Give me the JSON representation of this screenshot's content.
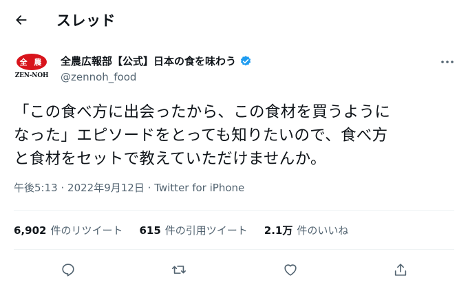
{
  "header": {
    "title": "スレッド",
    "back_icon": "arrow-left-icon"
  },
  "author": {
    "display_name": "全農広報部【公式】日本の食を味わう",
    "handle": "@zennoh_food",
    "verified_icon": "verified-badge-icon",
    "avatar": {
      "mark_text": "全 農",
      "logo_text": "ZEN-NOH",
      "color": "#d8141c"
    }
  },
  "tweet": {
    "text": "「この食べ方に出会ったから、この食材を買うように\nなった」エピソードをとっても知りたいので、食べ方\nと食材をセットで教えていただけませんか。",
    "time": "午後5:13",
    "separator": "·",
    "date": "2022年9月12日",
    "source": "Twitter for iPhone"
  },
  "stats": {
    "retweets": {
      "count": "6,902",
      "label": "件のリツイート"
    },
    "quotes": {
      "count": "615",
      "label": "件の引用ツイート"
    },
    "likes": {
      "count": "2.1万",
      "label": "件のいいね"
    }
  },
  "actions": [
    "reply-icon",
    "retweet-icon",
    "like-icon",
    "share-icon"
  ],
  "colors": {
    "verified": "#1d9bf0",
    "secondary_text": "#536471",
    "brand_red": "#d8141c"
  }
}
